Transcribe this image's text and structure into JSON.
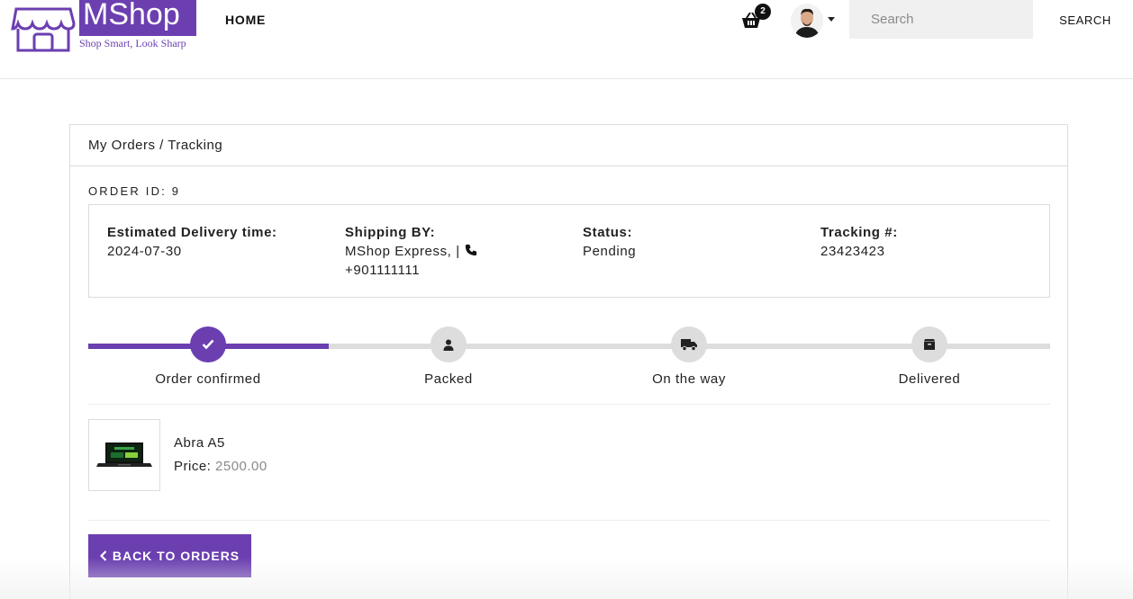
{
  "brand": {
    "name": "MShop",
    "tagline": "Shop Smart, Look Sharp",
    "color": "#6b3fb0"
  },
  "nav": {
    "home_label": "HOME",
    "cart_count": "2",
    "search_placeholder": "Search",
    "search_button": "SEARCH"
  },
  "breadcrumb": "My Orders / Tracking",
  "order": {
    "id_label": "ORDER ID: 9",
    "delivery_label": "Estimated Delivery time:",
    "delivery_value": "2024-07-30",
    "shipping_label": "Shipping BY:",
    "shipping_value": "MShop Express, |",
    "shipping_phone": "+901111111",
    "status_label": "Status:",
    "status_value": "Pending",
    "tracking_label": "Tracking #:",
    "tracking_value": "23423423"
  },
  "tracking_steps": [
    {
      "label": "Order confirmed",
      "icon": "check-icon",
      "active": true
    },
    {
      "label": "Packed",
      "icon": "user-icon",
      "active": false
    },
    {
      "label": "On the way",
      "icon": "truck-icon",
      "active": false
    },
    {
      "label": "Delivered",
      "icon": "box-icon",
      "active": false
    }
  ],
  "product": {
    "name": "Abra A5",
    "price_label": "Price:",
    "price_value": "2500.00"
  },
  "back_button": "BACK TO ORDERS"
}
